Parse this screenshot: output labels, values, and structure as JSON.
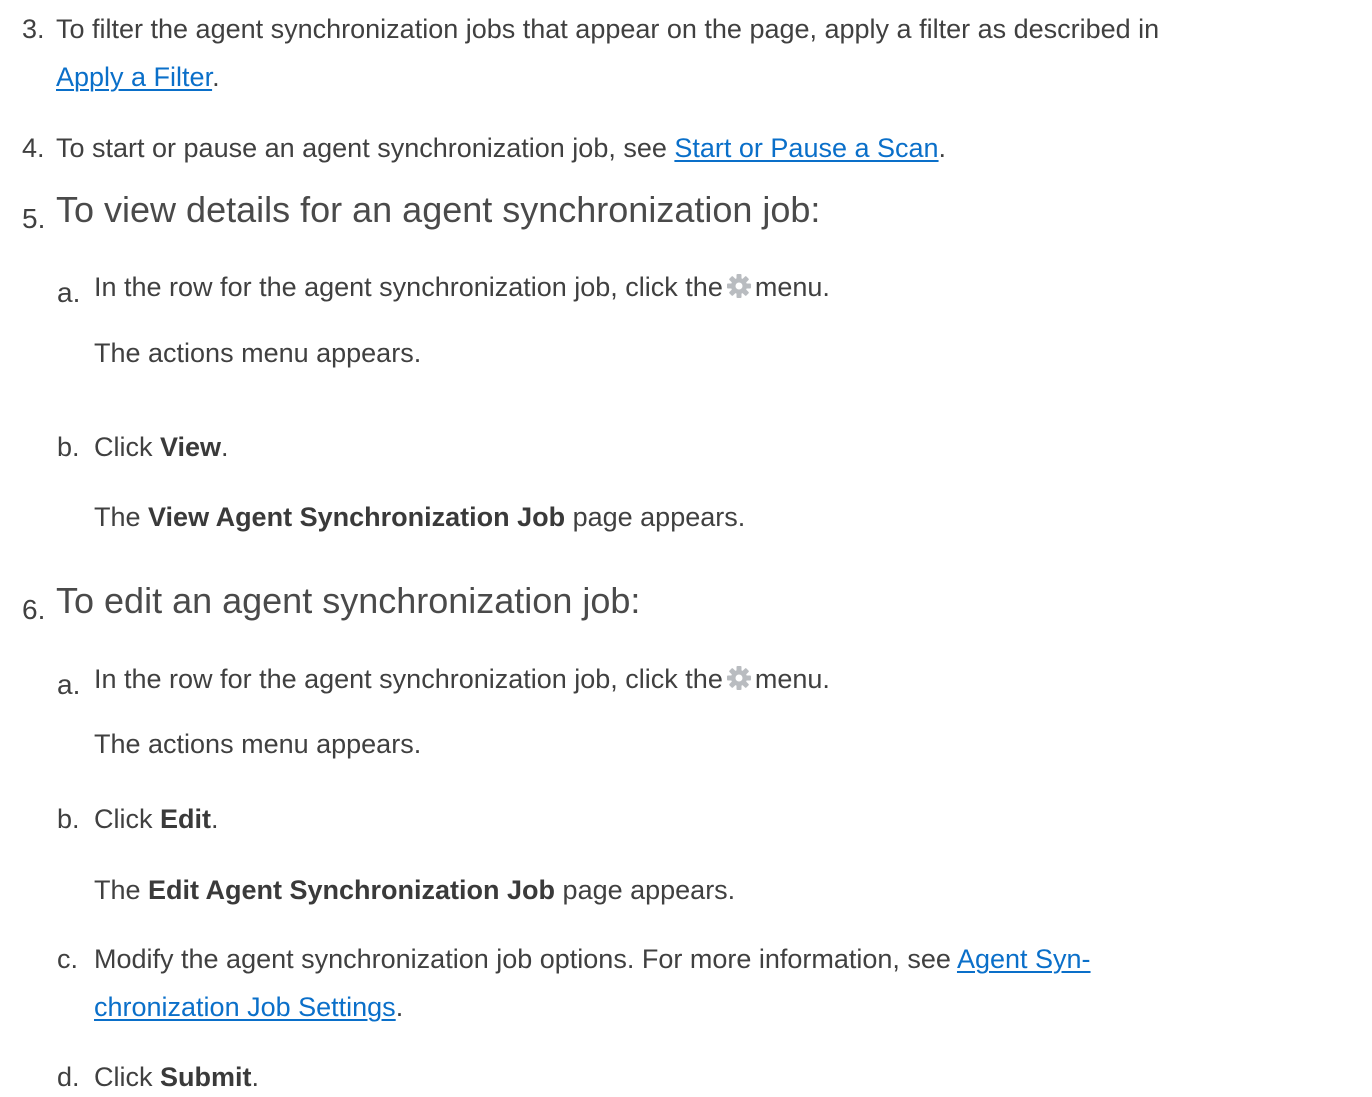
{
  "steps": [
    {
      "number": "3.",
      "line1": "To filter the agent synchronization jobs that appear on the page, apply a filter as described in",
      "link": "Apply a Filter",
      "after_link": "."
    },
    {
      "number": "4.",
      "before_link": "To start or pause an agent synchronization job, see ",
      "link": "Start or Pause a Scan",
      "after_link": "."
    },
    {
      "number": "5.",
      "heading": "To view details for an agent synchronization job:",
      "substeps": [
        {
          "letter": "a.",
          "before_icon": "In the row for the agent synchronization job, click the",
          "icon": "gear-icon",
          "after_icon": "menu.",
          "result": "The actions menu appears."
        },
        {
          "letter": "b.",
          "before_bold": "Click ",
          "bold": "View",
          "after_bold": ".",
          "result_before": "The ",
          "result_bold": "View Agent Synchronization Job",
          "result_after": " page appears."
        }
      ]
    },
    {
      "number": "6.",
      "heading": "To edit an agent synchronization job:",
      "substeps": [
        {
          "letter": "a.",
          "before_icon": "In the row for the agent synchronization job, click the",
          "icon": "gear-icon",
          "after_icon": "menu.",
          "result": "The actions menu appears."
        },
        {
          "letter": "b.",
          "before_bold": "Click ",
          "bold": "Edit",
          "after_bold": ".",
          "result_before": "The ",
          "result_bold": "Edit Agent Synchronization Job",
          "result_after": " page appears."
        },
        {
          "letter": "c.",
          "before_link": "Modify the agent synchronization job options. For more information, see ",
          "link_part1": "Agent Syn-",
          "link_part2": "chronization Job Settings",
          "after_link": "."
        },
        {
          "letter": "d.",
          "before_bold": "Click ",
          "bold": "Submit",
          "after_bold": "."
        }
      ]
    }
  ],
  "colors": {
    "text": "#404040",
    "link": "#0a6fc9",
    "icon": "#b9bcc0"
  }
}
